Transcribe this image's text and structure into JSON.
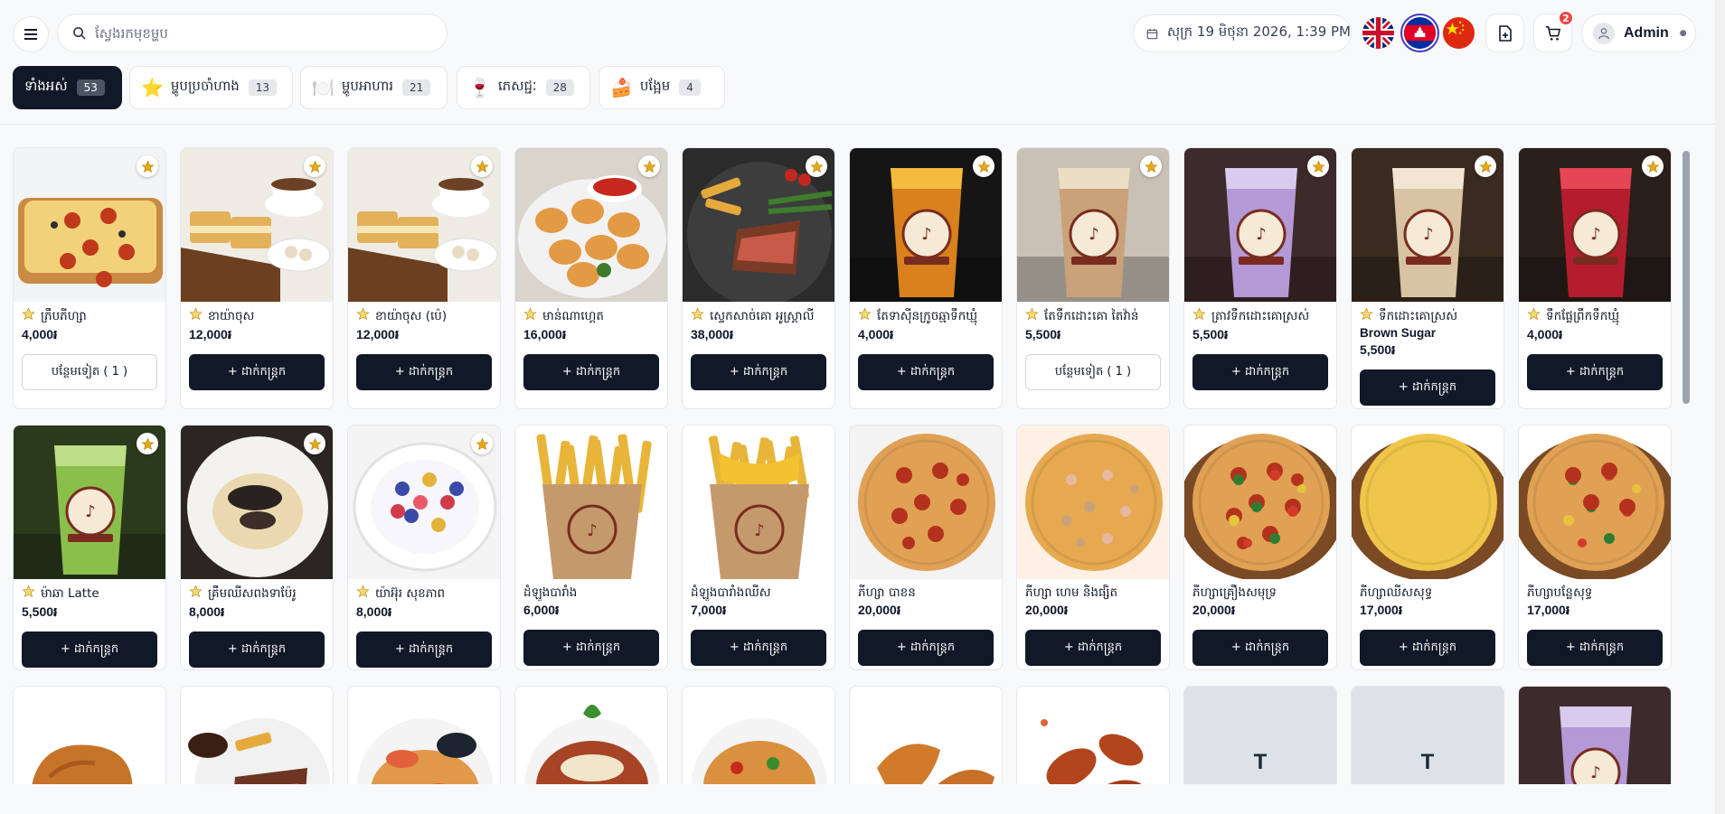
{
  "search": {
    "placeholder": "ស្វែងរកមុខម្ហូប"
  },
  "header": {
    "datetime": "សុក្រ 19 មិថុនា 2026, 1:39 PM",
    "cart_count": "2",
    "user_name": "Admin",
    "languages": [
      "en",
      "km",
      "zh"
    ]
  },
  "categories": [
    {
      "label": "ទាំងអស់",
      "count": "53",
      "icon": ""
    },
    {
      "label": "ម្ហូបប្រចាំហាង",
      "count": "13",
      "icon": "star-icon"
    },
    {
      "label": "ម្ហូបអាហារ",
      "count": "21",
      "icon": "dish-icon"
    },
    {
      "label": "ភេសជ្ជៈ",
      "count": "28",
      "icon": "drink-icon"
    },
    {
      "label": "បង្អែម",
      "count": "4",
      "icon": "cake-icon"
    }
  ],
  "buttons": {
    "add_to_cart": "+ ដាក់កន្ត្រក",
    "add_more": "បន្ថែមទៀត ( 1 )"
  },
  "products": [
    {
      "name": "ភ្រឹបភីហ្សា",
      "price": "4,000៛",
      "featured": true,
      "in_cart": true,
      "image": "pizza-toast"
    },
    {
      "name": "ខាយ៉ាចុស",
      "price": "12,000៛",
      "featured": true,
      "in_cart": false,
      "image": "toast-coffee"
    },
    {
      "name": "ខាយ៉ាចុស (ប៉េ)",
      "price": "12,000៛",
      "featured": true,
      "in_cart": false,
      "image": "toast-coffee"
    },
    {
      "name": "មាន់ណាហ្គេត",
      "price": "16,000៛",
      "featured": true,
      "in_cart": false,
      "image": "nuggets"
    },
    {
      "name": "ស្ទេកសាច់គោ អូស្ត្រាលី",
      "price": "38,000៛",
      "featured": true,
      "in_cart": false,
      "image": "steak"
    },
    {
      "name": "តែទាស៊ីនក្រូចឆ្មាទឹកឃ្មុំ",
      "price": "4,000៛",
      "featured": true,
      "in_cart": false,
      "image": "lemon-tea"
    },
    {
      "name": "តែទឹកដោះគោ តៃវ៉ាន់",
      "price": "5,500៛",
      "featured": true,
      "in_cart": true,
      "image": "milk-tea"
    },
    {
      "name": "ត្រាវទឹកដោះគោស្រស់",
      "price": "5,500៛",
      "featured": true,
      "in_cart": false,
      "image": "taro"
    },
    {
      "name": "ទឹកដោះគោស្រស់",
      "name2": "Brown Sugar",
      "price": "5,500៛",
      "featured": true,
      "in_cart": false,
      "image": "brown-sugar"
    },
    {
      "name": "ទឹកផ្លែព្រឹកទឹកឃ្មុំ",
      "price": "4,000៛",
      "featured": true,
      "in_cart": false,
      "image": "red-drink"
    },
    {
      "name": "ម៉ាឆា Latte",
      "price": "5,500៛",
      "featured": true,
      "in_cart": false,
      "image": "matcha"
    },
    {
      "name": "គ្រឹមឈីសពងទាប៉ែរូ",
      "price": "8,000៛",
      "featured": true,
      "in_cart": false,
      "image": "custard"
    },
    {
      "name": "យ៉ាអ៊ុរ សុខភាព",
      "price": "8,000៛",
      "featured": true,
      "in_cart": false,
      "image": "yogurt"
    },
    {
      "name": "ដំឡូងបារាំង",
      "price": "6,000៛",
      "featured": false,
      "in_cart": false,
      "image": "fries"
    },
    {
      "name": "ដំឡូងបារាំងឈីស",
      "price": "7,000៛",
      "featured": false,
      "in_cart": false,
      "image": "cheese-fries"
    },
    {
      "name": "ភីហ្សា បាខន",
      "price": "20,000៛",
      "featured": false,
      "in_cart": false,
      "image": "pizza-pepperoni"
    },
    {
      "name": "ភីហ្សា ហេម និងផ្សិត",
      "price": "20,000៛",
      "featured": false,
      "in_cart": false,
      "image": "pizza-ham"
    },
    {
      "name": "ភីហ្សាគ្រឿងសមុទ្រ",
      "price": "20,000៛",
      "featured": false,
      "in_cart": false,
      "image": "pizza-seafood"
    },
    {
      "name": "ភីហ្សាឈីសសុទ្ធ",
      "price": "17,000៛",
      "featured": false,
      "in_cart": false,
      "image": "pizza-cheese"
    },
    {
      "name": "ភីហ្សាបន្លែសុទ្ធ",
      "price": "17,000៛",
      "featured": false,
      "in_cart": false,
      "image": "pizza-veggie"
    },
    {
      "name": "",
      "price": "",
      "image": "fried-chicken"
    },
    {
      "name": "",
      "price": "",
      "image": "steak-plate"
    },
    {
      "name": "",
      "price": "",
      "image": "seafood-pasta"
    },
    {
      "name": "",
      "price": "",
      "image": "bolognese"
    },
    {
      "name": "",
      "price": "",
      "image": "noodles"
    },
    {
      "name": "",
      "price": "",
      "image": "wings"
    },
    {
      "name": "",
      "price": "",
      "image": "hot-wings"
    },
    {
      "name": "",
      "price": "",
      "image": "placeholder",
      "letter": "T"
    },
    {
      "name": "",
      "price": "",
      "image": "placeholder",
      "letter": "T"
    },
    {
      "name": "",
      "price": "",
      "image": "taro"
    }
  ]
}
